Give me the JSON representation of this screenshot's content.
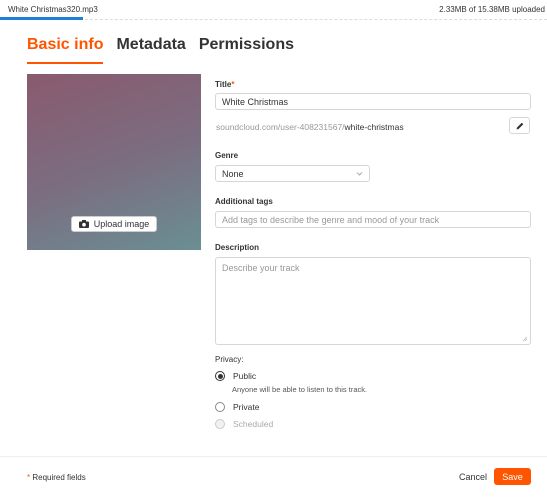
{
  "upload": {
    "file_name": "White Christmas320.mp3",
    "status": "2.33MB of 15.38MB uploaded",
    "progress_fraction": 0.151
  },
  "tabs": [
    {
      "label": "Basic info",
      "active": true
    },
    {
      "label": "Metadata",
      "active": false
    },
    {
      "label": "Permissions",
      "active": false
    }
  ],
  "artwork": {
    "upload_label": "Upload image",
    "icon": "camera-icon"
  },
  "form": {
    "title_label": "Title",
    "required_mark": "*",
    "title_value": "White Christmas",
    "permalink_base": "soundcloud.com/user-408231567/",
    "permalink_slug": "white-christmas",
    "edit_icon": "pencil-icon",
    "genre_label": "Genre",
    "genre_value": "None",
    "tags_label": "Additional tags",
    "tags_placeholder": "Add tags to describe the genre and mood of your track",
    "description_label": "Description",
    "description_placeholder": "Describe your track"
  },
  "privacy": {
    "label": "Privacy:",
    "options": [
      {
        "label": "Public",
        "checked": true,
        "disabled": false,
        "note": "Anyone will be able to listen to this track."
      },
      {
        "label": "Private",
        "checked": false,
        "disabled": false
      },
      {
        "label": "Scheduled",
        "checked": false,
        "disabled": true
      }
    ]
  },
  "footer": {
    "required_star": "*",
    "required_text": "Required fields",
    "cancel_label": "Cancel",
    "save_label": "Save"
  },
  "colors": {
    "accent": "#ff5500",
    "progress": "#1e7fd6"
  }
}
